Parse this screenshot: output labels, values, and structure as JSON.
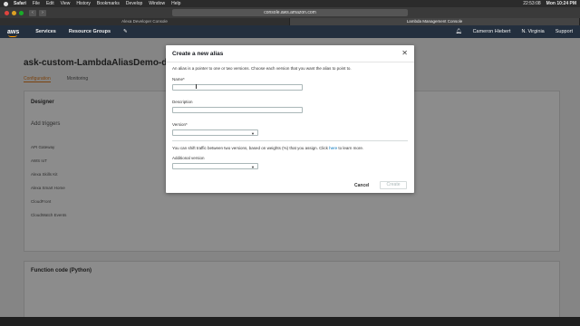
{
  "menubar": {
    "app": "Safari",
    "items": [
      "File",
      "Edit",
      "View",
      "History",
      "Bookmarks",
      "Develop",
      "Window",
      "Help"
    ],
    "clock_left": "22:53:08",
    "clock": "Mon 10:24 PM"
  },
  "browser": {
    "url": "console.aws.amazon.com",
    "tabs": [
      "Alexa Developer Console",
      "Lambda Management Console"
    ]
  },
  "aws_header": {
    "logo": "aws",
    "services": "Services",
    "resource_groups": "Resource Groups",
    "user": "Cameron Hiebert",
    "region": "N. Virginia",
    "support": "Support"
  },
  "background_page": {
    "title": "ask-custom-LambdaAliasDemo-default",
    "tabs": [
      "Configuration",
      "Monitoring"
    ],
    "section": "Designer",
    "add_triggers": "Add triggers",
    "triggers": [
      "API Gateway",
      "AWS IoT",
      "Alexa Skills Kit",
      "Alexa Smart Home",
      "CloudFront",
      "CloudWatch Events"
    ],
    "function_code": "Function code (Python)"
  },
  "modal": {
    "title": "Create a new alias",
    "description": "An alias is a pointer to one or two versions. Choose each version that you want the alias to point to.",
    "name_label": "Name*",
    "name_value": "",
    "description_label": "Description",
    "description_value": "",
    "version_label": "Version*",
    "version_value": "",
    "shift_info_prefix": "You can shift traffic between two versions, based on weights (%) that you assign. Click ",
    "shift_info_link": "here",
    "shift_info_suffix": " to learn more.",
    "additional_version_label": "Additional version",
    "additional_version_value": "",
    "cancel": "Cancel",
    "create": "Create"
  }
}
